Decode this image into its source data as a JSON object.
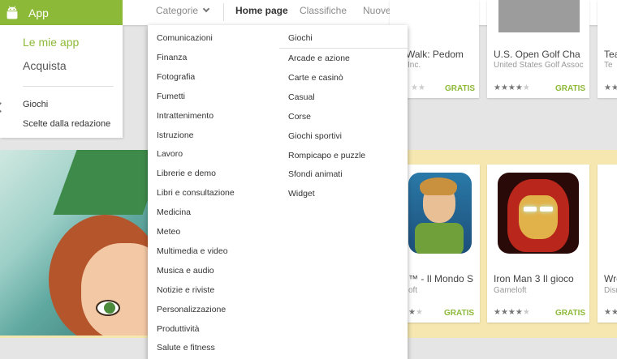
{
  "topbar": {
    "app_label": "App",
    "nav": {
      "categorie": "Categorie",
      "home": "Home page",
      "classifiche": "Classifiche",
      "nuove_uscite": "Nuove uscite"
    }
  },
  "sidemenu": {
    "my_apps": "Le mie app",
    "acquista": "Acquista",
    "giochi": "Giochi",
    "scelte": "Scelte dalla redazione"
  },
  "dropdown": {
    "col1": [
      "Comunicazioni",
      "Finanza",
      "Fotografia",
      "Fumetti",
      "Intrattenimento",
      "Istruzione",
      "Lavoro",
      "Librerie e demo",
      "Libri e consultazione",
      "Medicina",
      "Meteo",
      "Multimedia e video",
      "Musica e audio",
      "Notizie e riviste",
      "Personalizzazione",
      "Produttività",
      "Salute e fitness"
    ],
    "col2_header": "Giochi",
    "col2": [
      "Arcade e azione",
      "Carte e casinò",
      "Casual",
      "Corse",
      "Giochi sportivi",
      "Rompicapo e puzzle",
      "Sfondi animati",
      "Widget"
    ]
  },
  "cards_top": [
    {
      "title": "Walk: Pedom",
      "developer": "Inc.",
      "stars": 4,
      "price": "GRATIS"
    },
    {
      "title": "U.S. Open Golf Cha",
      "developer": "United States Golf Assoc",
      "stars": 4,
      "price": "GRATIS"
    },
    {
      "title": "Tea",
      "developer": "Te",
      "stars": 4,
      "price": ""
    }
  ],
  "cards_banner": [
    {
      "title": "™ - Il Mondo S",
      "developer": "oft",
      "stars": 4,
      "price": "GRATIS"
    },
    {
      "title": "Iron Man 3 Il gioco",
      "developer": "Gameloft",
      "stars": 4,
      "price": "GRATIS"
    },
    {
      "title": "Wre",
      "developer": "Disn",
      "stars": 4,
      "price": ""
    }
  ],
  "colors": {
    "accent": "#8db938",
    "banner_bg": "#f6e7b0"
  },
  "icons": [
    "android-icon",
    "chevron-down-icon",
    "chevron-left-icon",
    "star-icon"
  ]
}
